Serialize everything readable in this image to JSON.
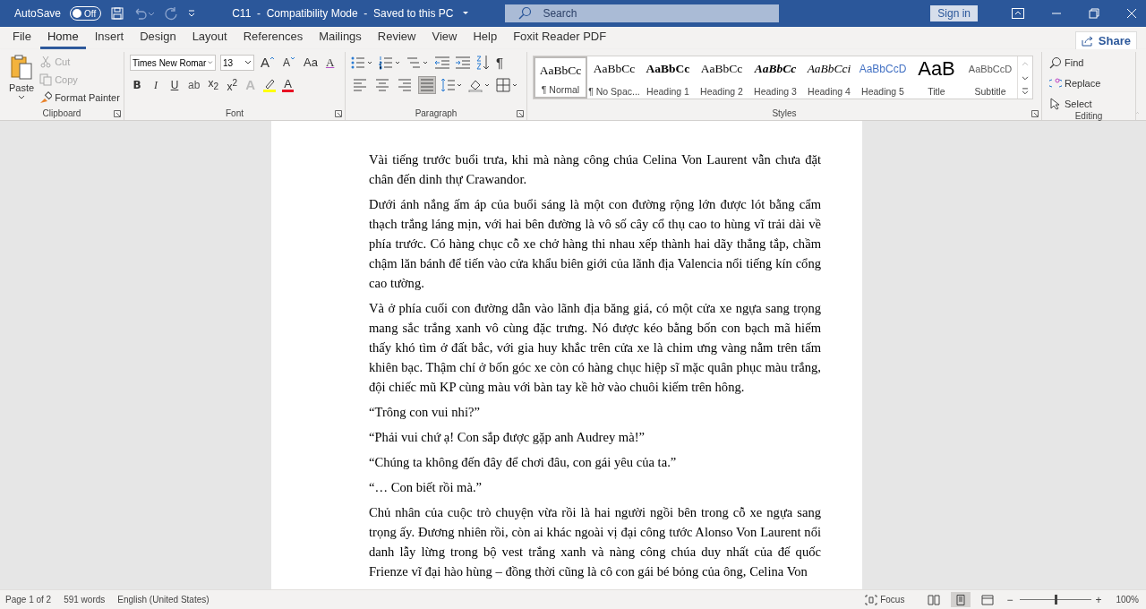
{
  "title_bar": {
    "autosave_label": "AutoSave",
    "autosave": {
      "label": "Off",
      "on": false
    },
    "document_title": "C11  -  Compatibility Mode  -  Saved to this PC",
    "search": {
      "placeholder": "Search"
    },
    "sign_in": "Sign in"
  },
  "tabs": [
    {
      "label": "File",
      "selected": false
    },
    {
      "label": "Home",
      "selected": true
    },
    {
      "label": "Insert",
      "selected": false
    },
    {
      "label": "Design",
      "selected": false
    },
    {
      "label": "Layout",
      "selected": false
    },
    {
      "label": "References",
      "selected": false
    },
    {
      "label": "Mailings",
      "selected": false
    },
    {
      "label": "Review",
      "selected": false
    },
    {
      "label": "View",
      "selected": false
    },
    {
      "label": "Help",
      "selected": false
    },
    {
      "label": "Foxit Reader PDF",
      "selected": false
    }
  ],
  "share": "Share",
  "clipboard": {
    "paste": "Paste",
    "actions": [
      {
        "label": "Cut",
        "kind": "cut",
        "disabled": true
      },
      {
        "label": "Copy",
        "kind": "copy",
        "disabled": true
      },
      {
        "label": "Format Painter",
        "kind": "painter",
        "disabled": false
      }
    ],
    "label": "Clipboard"
  },
  "font": {
    "font_name": "Times New Romar",
    "font_size": "13",
    "grow": "A",
    "shrink": "A",
    "change_case": "Aa",
    "clear_format": "A",
    "format_buttons": [
      {
        "label": "B",
        "kind": "bold"
      },
      {
        "label": "I",
        "kind": "italic"
      },
      {
        "label": "U",
        "kind": "underline"
      },
      {
        "label": "ab",
        "kind": "strike"
      },
      {
        "label": "x$_{2}$",
        "kind": "sub"
      },
      {
        "label": "x$^{2}$",
        "kind": "sup"
      }
    ],
    "text_effects": "A",
    "font_color": "A",
    "label": "Font"
  },
  "paragraph": {
    "show_marks": "¶",
    "alignments": [
      {
        "kind": "left",
        "selected": false
      },
      {
        "kind": "center",
        "selected": false
      },
      {
        "kind": "right",
        "selected": false
      },
      {
        "kind": "justify",
        "selected": true
      }
    ],
    "label": "Paragraph"
  },
  "styles": {
    "items": [
      {
        "preview": "AaBbCc",
        "name": "¶ Normal",
        "kind": "normal",
        "selected": true
      },
      {
        "preview": "AaBbCc",
        "name": "¶ No Spac...",
        "kind": "nospacing",
        "selected": false
      },
      {
        "preview": "AaBbCc",
        "name": "Heading 1",
        "kind": "h1",
        "selected": false
      },
      {
        "preview": "AaBbCc",
        "name": "Heading 2",
        "kind": "h2",
        "selected": false
      },
      {
        "preview": "AaBbCc",
        "name": "Heading 3",
        "kind": "h3",
        "selected": false
      },
      {
        "preview": "AaBbCci",
        "name": "Heading 4",
        "kind": "h4",
        "selected": false
      },
      {
        "preview": "AaBbCcD",
        "name": "Heading 5",
        "kind": "h5",
        "selected": false
      },
      {
        "preview": "AaB",
        "name": "Title",
        "kind": "title",
        "selected": false
      },
      {
        "preview": "AaBbCcD",
        "name": "Subtitle",
        "kind": "subtitle",
        "selected": false
      }
    ],
    "label": "Styles"
  },
  "editing": {
    "actions": [
      {
        "label": "Find",
        "kind": "find"
      },
      {
        "label": "Replace",
        "kind": "replace"
      },
      {
        "label": "Select",
        "kind": "select"
      }
    ],
    "label": "Editing"
  },
  "document": {
    "paragraphs": [
      "Vài tiếng trước buổi trưa, khi mà nàng công chúa Celina Von Laurent vẫn chưa đặt chân đến dinh thự Crawandor.",
      "Dưới ánh nắng ấm áp của buổi sáng là một con đường rộng lớn được lót bằng cẩm thạch trắng láng mịn, với hai bên đường là vô số cây cổ thụ cao to hùng vĩ trải dài về phía trước. Có hàng chục cỗ xe chở hàng thi nhau xếp thành hai dãy thẳng tắp, chầm chậm lăn bánh để tiến vào cửa khẩu biên giới của lãnh địa Valencia nổi tiếng kín cổng cao tường.",
      "Và ở phía cuối con đường dẫn vào lãnh địa băng giá, có một cửa xe ngựa sang trọng mang sắc trắng xanh vô cùng đặc trưng. Nó được kéo bằng bốn con bạch mã hiếm thấy khó tìm ở đất bắc, với gia huy khắc trên cửa xe là chim ưng vàng nằm trên tấm khiên bạc. Thậm chí ở bốn góc xe còn có hàng chục hiệp sĩ mặc quân phục màu trắng, đội chiếc mũ KP cùng màu với bàn tay kề hờ vào chuôi kiếm trên hông.",
      "“Trông con vui nhỉ?”",
      "“Phải vui chứ ạ! Con sắp được gặp anh Audrey mà!”",
      "“Chúng ta không đến đây để chơi đâu, con gái yêu của ta.”",
      "“… Con biết rồi mà.”",
      "Chủ nhân của cuộc trò chuyện vừa rồi là hai người ngồi bên trong cỗ xe ngựa sang trọng ấy. Đương nhiên rồi, còn ai khác ngoài vị đại công tước Alonso Von Laurent nổi danh lẫy lừng trong bộ vest trắng xanh và nàng công chúa duy nhất của đế quốc Frienze vĩ đại hào hùng – đồng thời cũng là cô con gái bé bỏng của ông, Celina Von"
    ]
  },
  "status_bar": {
    "page": "Page 1 of 2",
    "words": "591 words",
    "language": "English (United States)",
    "focus": "Focus",
    "views": [
      {
        "kind": "read",
        "selected": false
      },
      {
        "kind": "print",
        "selected": true
      },
      {
        "kind": "web",
        "selected": false
      }
    ],
    "zoom_out": "−",
    "zoom_in": "+",
    "zoom": {
      "level": 0.5
    },
    "zoom_label": "100%"
  }
}
